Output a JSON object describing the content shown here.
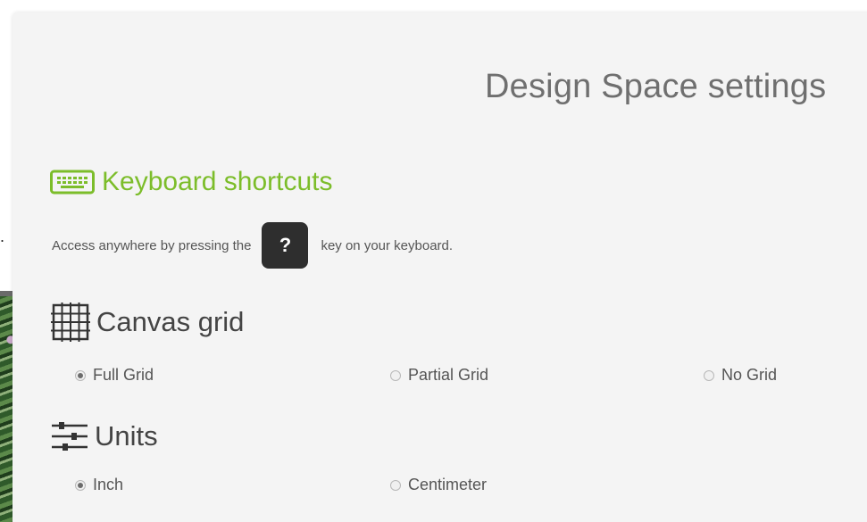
{
  "background": {
    "fragment_text": "."
  },
  "panel": {
    "title": "Design Space settings"
  },
  "keyboard": {
    "icon": "keyboard-icon",
    "heading": "Keyboard shortcuts",
    "text_before": "Access anywhere by pressing the",
    "key": "?",
    "text_after": "key on your keyboard.",
    "accent_color": "#7cbd2a"
  },
  "canvas_grid": {
    "icon": "grid-icon",
    "heading": "Canvas grid",
    "options": [
      {
        "label": "Full Grid",
        "checked": true
      },
      {
        "label": "Partial Grid",
        "checked": false
      },
      {
        "label": "No Grid",
        "checked": false
      }
    ]
  },
  "units": {
    "icon": "sliders-icon",
    "heading": "Units",
    "options": [
      {
        "label": "Inch",
        "checked": true
      },
      {
        "label": "Centimeter",
        "checked": false
      }
    ]
  }
}
